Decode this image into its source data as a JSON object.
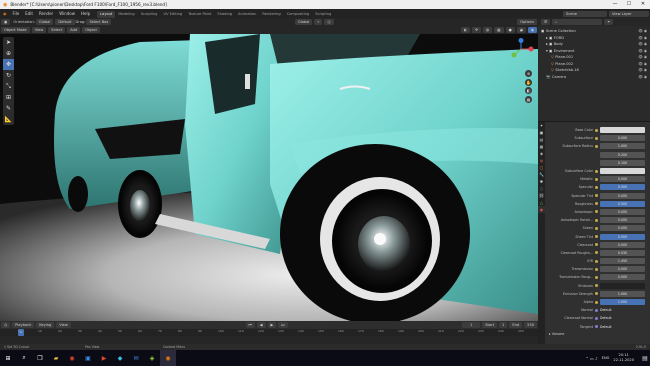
{
  "window": {
    "title": "Blender* [C:\\Users\\pioner\\Desktop\\Ford F100\\Ford_F100_1956_rev3.blend]",
    "min": "—",
    "max": "☐",
    "close": "✕"
  },
  "menu": {
    "items": [
      "File",
      "Edit",
      "Render",
      "Window",
      "Help"
    ],
    "workspaces": [
      "Layout",
      "Modeling",
      "Sculpting",
      "UV Editing",
      "Texture Paint",
      "Shading",
      "Animation",
      "Rendering",
      "Compositing",
      "Scripting"
    ],
    "active_workspace": "Layout",
    "scene": "Scene",
    "view_layer": "View Layer"
  },
  "viewport_header": {
    "orientation_label": "Orientation:",
    "orientation": "Global",
    "pivot": "Default",
    "drag_label": "Drag:",
    "drag": "Select Box",
    "transform": "Global",
    "options": "Options"
  },
  "viewport_header2": {
    "mode": "Object Mode",
    "menus": [
      "View",
      "Select",
      "Add",
      "Object"
    ]
  },
  "tools": [
    {
      "name": "select-tool",
      "glyph": "➤"
    },
    {
      "name": "cursor-tool",
      "glyph": "⊕"
    },
    {
      "name": "move-tool",
      "glyph": "✥"
    },
    {
      "name": "rotate-tool",
      "glyph": "↻"
    },
    {
      "name": "scale-tool",
      "glyph": "⤡"
    },
    {
      "name": "transform-tool",
      "glyph": "⊞"
    },
    {
      "name": "annotate-tool",
      "glyph": "✎"
    },
    {
      "name": "measure-tool",
      "glyph": "📐"
    }
  ],
  "outliner": {
    "rows": [
      {
        "label": "Scene Collection",
        "indent": 0
      },
      {
        "label": "FORD",
        "indent": 1
      },
      {
        "label": "Body",
        "indent": 1
      },
      {
        "label": "Enviroment",
        "indent": 1
      },
      {
        "label": "Plane.001",
        "indent": 2
      },
      {
        "label": "Plane.002",
        "indent": 2
      },
      {
        "label": "Sketchfab.18",
        "indent": 2
      },
      {
        "label": "Camera",
        "indent": 1
      }
    ]
  },
  "material_props": [
    {
      "label": "Base Color",
      "value": "",
      "style": "color"
    },
    {
      "label": "Subsurface",
      "value": "0.000",
      "style": ""
    },
    {
      "label": "Subsurface Radius",
      "value": "1.000",
      "style": ""
    },
    {
      "label": "",
      "value": "0.200",
      "style": ""
    },
    {
      "label": "",
      "value": "0.100",
      "style": ""
    },
    {
      "label": "Subsurface Color",
      "value": "",
      "style": "color"
    },
    {
      "label": "Metallic",
      "value": "0.000",
      "style": ""
    },
    {
      "label": "Specular",
      "value": "0.500",
      "style": "blue"
    },
    {
      "label": "Specular Tint",
      "value": "0.000",
      "style": ""
    },
    {
      "label": "Roughness",
      "value": "0.500",
      "style": "blue"
    },
    {
      "label": "Anisotropic",
      "value": "0.000",
      "style": ""
    },
    {
      "label": "Anisotropic Rotati...",
      "value": "0.000",
      "style": ""
    },
    {
      "label": "Sheen",
      "value": "0.000",
      "style": ""
    },
    {
      "label": "Sheen Tint",
      "value": "0.500",
      "style": "blue"
    },
    {
      "label": "Clearcoat",
      "value": "0.000",
      "style": ""
    },
    {
      "label": "Clearcoat Roughn...",
      "value": "0.030",
      "style": ""
    },
    {
      "label": "IOR",
      "value": "1.450",
      "style": ""
    },
    {
      "label": "Transmission",
      "value": "0.000",
      "style": ""
    },
    {
      "label": "Transmission Roug...",
      "value": "0.000",
      "style": ""
    },
    {
      "label": "Emission",
      "value": "",
      "style": "dark"
    },
    {
      "label": "Emission Strength",
      "value": "1.000",
      "style": ""
    },
    {
      "label": "Alpha",
      "value": "1.000",
      "style": "blue"
    },
    {
      "label": "Normal",
      "value": "Default",
      "style": "plain"
    },
    {
      "label": "Clearcoat Normal",
      "value": "Default",
      "style": "plain"
    },
    {
      "label": "Tangent",
      "value": "Default",
      "style": "plain"
    }
  ],
  "volume_label": "Volume",
  "timeline": {
    "playback": "Playback",
    "keying": "Keying",
    "view": "View",
    "current": "1",
    "start_label": "Start",
    "start": "1",
    "end_label": "End",
    "end": "250",
    "ticks": [
      "0",
      "10",
      "20",
      "30",
      "40",
      "50",
      "60",
      "70",
      "80",
      "90",
      "100",
      "110",
      "120",
      "130",
      "140",
      "150",
      "160",
      "170",
      "180",
      "190",
      "200",
      "210",
      "220",
      "230",
      "240",
      "250"
    ]
  },
  "statusbar": {
    "left": "Set 3D Cursor",
    "mid1": "Pan View",
    "mid2": "Context Menu",
    "version": "2.91.0"
  },
  "taskbar": {
    "time": "20:11",
    "date": "22.11.2020",
    "lang": "ENG"
  },
  "colors": {
    "accent": "#4772b3",
    "truck": "#6fd3cc"
  }
}
